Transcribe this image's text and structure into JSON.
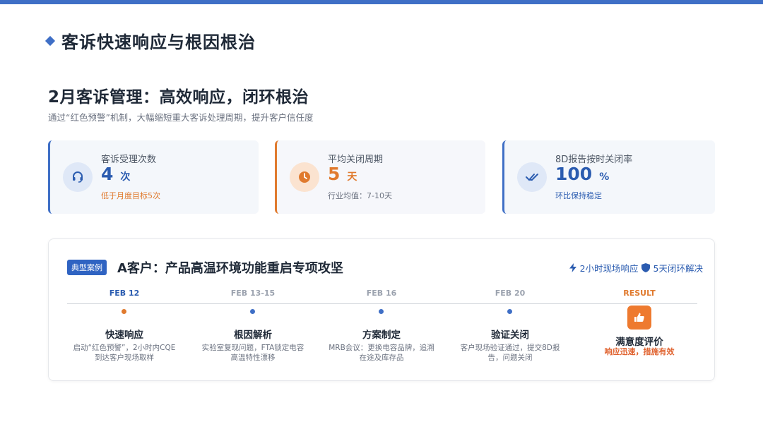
{
  "page": {
    "title": "客诉快速响应与根因根治",
    "headline": "2月客诉管理：高效响应，闭环根治",
    "subline": "通过“红色预警”机制，大幅缩短重大客诉处理周期，提升客户信任度"
  },
  "kpis": [
    {
      "icon": "headset-icon",
      "label": "客诉受理次数",
      "value": "4",
      "unit": "次",
      "note": "低于月度目标5次"
    },
    {
      "icon": "clock-icon",
      "label": "平均关闭周期",
      "value": "5",
      "unit": "天",
      "note": "行业均值：7-10天"
    },
    {
      "icon": "check-double-icon",
      "label": "8D报告按时关闭率",
      "value": "100",
      "unit": "%",
      "note": "环比保持稳定"
    }
  ],
  "case": {
    "tag": "典型案例",
    "title": "A客户：产品高温环境功能重启专项攻坚",
    "badge_1": "2小时现场响应",
    "badge_2": "5天闭环解决",
    "timeline": [
      {
        "date": "FEB 12",
        "name": "快速响应",
        "desc": "启动“红色预警”，2小时内CQE到达客户现场取样"
      },
      {
        "date": "FEB 13-15",
        "name": "根因解析",
        "desc": "实验室复现问题，FTA锁定电容高温特性漂移"
      },
      {
        "date": "FEB 16",
        "name": "方案制定",
        "desc": "MRB会议：更换电容品牌，追溯在途及库存品"
      },
      {
        "date": "FEB 20",
        "name": "验证关闭",
        "desc": "客户现场验证通过，提交8D报告，问题关闭"
      },
      {
        "date": "RESULT",
        "name": "满意度评价",
        "desc": "响应迅速，措施有效"
      }
    ]
  },
  "colors": {
    "primary": "#3f6fc6",
    "accent": "#e07a2e"
  }
}
